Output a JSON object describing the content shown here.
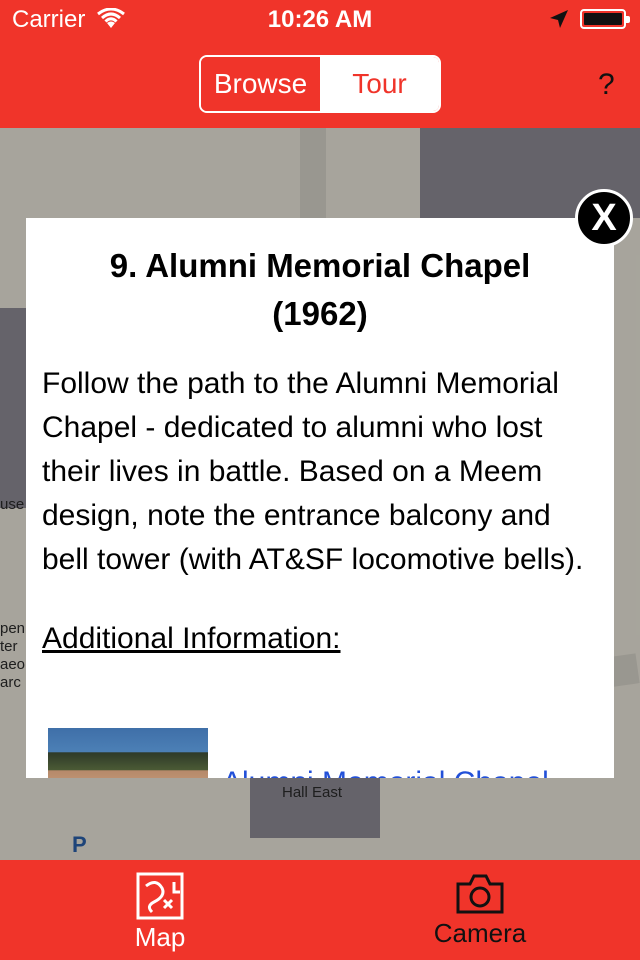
{
  "status_bar": {
    "carrier": "Carrier",
    "time": "10:26 AM"
  },
  "nav": {
    "segments": [
      {
        "label": "Browse",
        "selected": true
      },
      {
        "label": "Tour",
        "selected": false
      }
    ],
    "help_label": "?"
  },
  "map": {
    "labels": [
      "Hall East",
      "P",
      "pen",
      "ter",
      "aeo",
      "arc",
      "use"
    ]
  },
  "popup": {
    "title": "9. Alumni Memorial Chapel (1962)",
    "body": "Follow the path to the Alumni Memorial Chapel - dedicated to alumni who lost their lives in battle. Based on a Meem design, note the entrance balcony and bell tower (with AT&SF locomotive bells).",
    "section_heading": "Additional Information:",
    "link_text": "Alumni Memorial Chapel",
    "close_label": "X"
  },
  "tabbar": {
    "items": [
      {
        "label": "Map",
        "icon": "map-icon"
      },
      {
        "label": "Camera",
        "icon": "camera-icon"
      }
    ]
  },
  "colors": {
    "brand_red": "#f0342a",
    "link_blue": "#2250d8"
  }
}
